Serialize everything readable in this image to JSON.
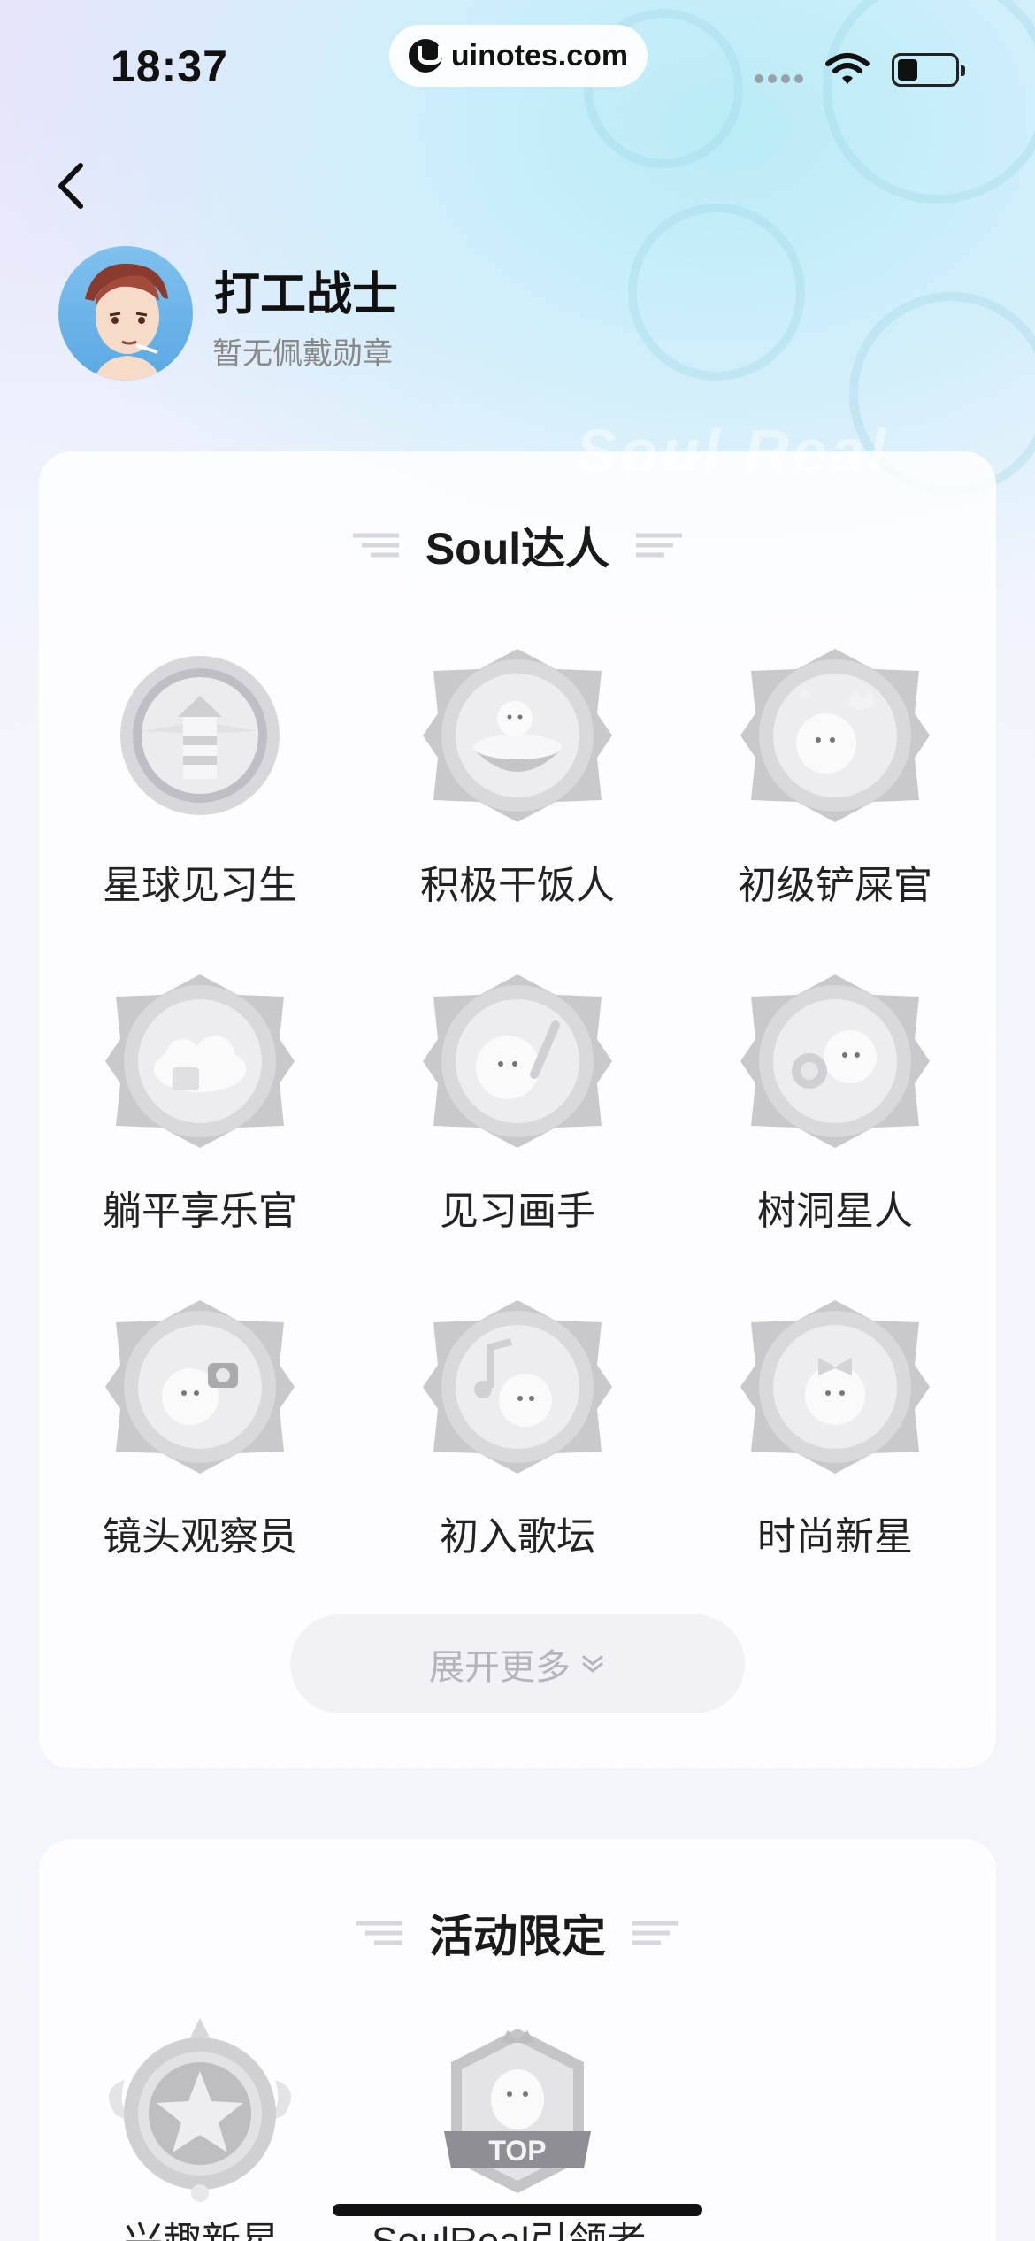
{
  "status_bar": {
    "time": "18:37",
    "url": "uinotes.com"
  },
  "profile": {
    "name": "打工战士",
    "badge_status": "暂无佩戴勋章"
  },
  "hero": {
    "watermark": "Soul Real"
  },
  "sections": [
    {
      "title": "Soul达人",
      "badges": [
        {
          "label": "星球见习生",
          "icon": "lighthouse-badge-icon"
        },
        {
          "label": "积极干饭人",
          "icon": "rice-bowl-badge-icon"
        },
        {
          "label": "初级铲屎官",
          "icon": "cat-badge-icon"
        },
        {
          "label": "躺平享乐官",
          "icon": "cloud-bed-badge-icon"
        },
        {
          "label": "见习画手",
          "icon": "paintbrush-badge-icon"
        },
        {
          "label": "树洞星人",
          "icon": "tree-hole-badge-icon"
        },
        {
          "label": "镜头观察员",
          "icon": "camera-badge-icon"
        },
        {
          "label": "初入歌坛",
          "icon": "music-note-badge-icon"
        },
        {
          "label": "时尚新星",
          "icon": "bow-badge-icon"
        }
      ],
      "expand_label": "展开更多"
    },
    {
      "title": "活动限定",
      "badges": [
        {
          "label": "兴趣新星",
          "icon": "star-wings-badge-icon"
        },
        {
          "label": "SoulReal引领者",
          "icon": "top-crown-badge-icon",
          "badge_text": "TOP"
        }
      ]
    }
  ],
  "colors": {
    "accent_cyan": "#b9ecf6",
    "card_bg": "#ffffff",
    "muted_text": "#888888",
    "badge_gray": "#bdbdc2"
  }
}
